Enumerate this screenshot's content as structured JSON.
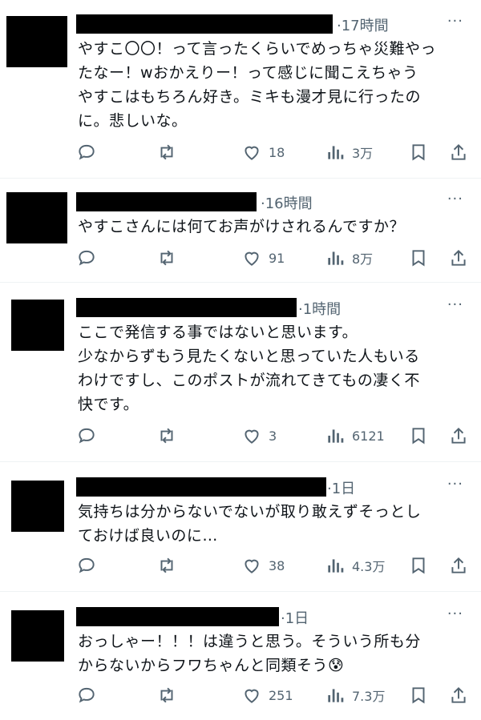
{
  "posts": [
    {
      "time": "·17時間",
      "more": "···",
      "text": "やすこ〇〇！って言ったくらいでめっちゃ災難やったなー！wおかえりー！って感じに聞こえちゃうやすこはもちろん好き。ミキも漫才見に行ったのに。悲しいな。",
      "lines": [
        "やすこ〇〇！って言ったくらいでめっちゃ災難やっ",
        "たなー！wおかえりー！って感じに聞こえちゃう",
        "やすこはもちろん好き。ミキも漫才見に行ったの",
        "に。悲しいな。"
      ],
      "likes": "18",
      "views": "3万"
    },
    {
      "time": "·16時間",
      "more": "···",
      "lines": [
        "やすこさんには何てお声がけされるんですか？"
      ],
      "likes": "91",
      "views": "8万"
    },
    {
      "time": "·1時間",
      "more": "···",
      "lines": [
        "ここで発信する事ではないと思います。",
        "少なからずもう見たくないと思っていた人もいる",
        "わけですし、このポストが流れてきてもの凄く不",
        "快です。"
      ],
      "likes": "3",
      "views": "6121"
    },
    {
      "time": "·1日",
      "more": "···",
      "lines": [
        "気持ちは分からないでないが取り敢えずそっとし",
        "ておけば良いのに…"
      ],
      "likes": "38",
      "views": "4.3万"
    },
    {
      "time": "·1日",
      "more": "···",
      "lines": [
        "おっしゃー！！！は違うと思う。そういう所も分",
        "からないからフワちゃんと同類そう😰"
      ],
      "likes": "251",
      "views": "7.3万"
    }
  ],
  "icons": [
    "reply-icon",
    "retweet-icon",
    "like-icon",
    "views-icon",
    "bookmark-icon",
    "share-icon"
  ]
}
